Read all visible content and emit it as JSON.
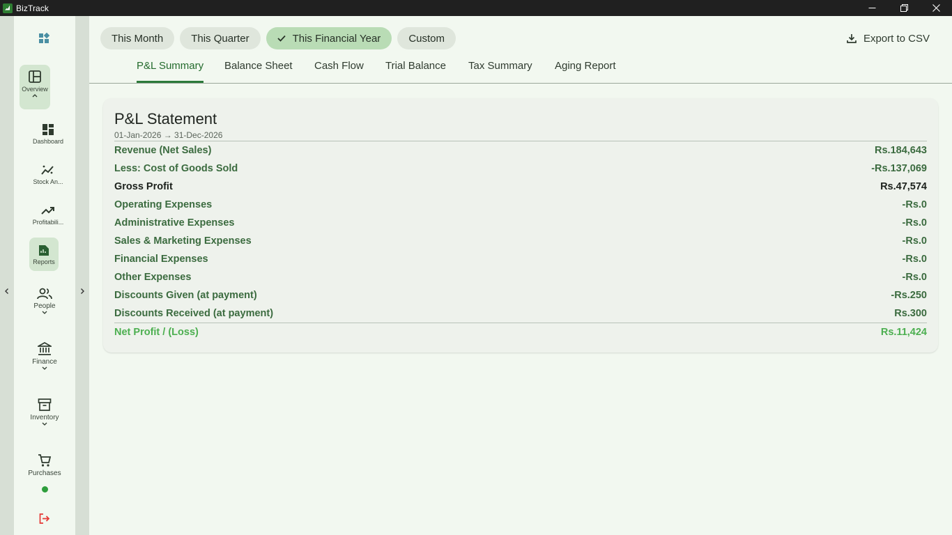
{
  "window": {
    "title": "BizTrack"
  },
  "sidebar": {
    "items": [
      {
        "key": "overview",
        "label": "Overview",
        "icon": "overview-layout-icon"
      },
      {
        "key": "dashboard",
        "label": "Dashboard",
        "icon": "dashboard-icon"
      },
      {
        "key": "stock",
        "label": "Stock An...",
        "icon": "stock-analytics-icon"
      },
      {
        "key": "profitability",
        "label": "Profitabili...",
        "icon": "trending-up-icon"
      },
      {
        "key": "reports",
        "label": "Reports",
        "icon": "reports-icon"
      },
      {
        "key": "people",
        "label": "People",
        "icon": "people-icon"
      },
      {
        "key": "finance",
        "label": "Finance",
        "icon": "bank-icon"
      },
      {
        "key": "inventory",
        "label": "Inventory",
        "icon": "inventory-box-icon"
      },
      {
        "key": "purchases",
        "label": "Purchases",
        "icon": "cart-icon"
      }
    ]
  },
  "filters": {
    "chips": [
      {
        "label": "This Month",
        "selected": false
      },
      {
        "label": "This Quarter",
        "selected": false
      },
      {
        "label": "This Financial Year",
        "selected": true
      },
      {
        "label": "Custom",
        "selected": false
      }
    ],
    "export_label": "Export to CSV"
  },
  "tabs": [
    {
      "label": "P&L Summary",
      "active": true
    },
    {
      "label": "Balance Sheet",
      "active": false
    },
    {
      "label": "Cash Flow",
      "active": false
    },
    {
      "label": "Trial Balance",
      "active": false
    },
    {
      "label": "Tax Summary",
      "active": false
    },
    {
      "label": "Aging Report",
      "active": false
    }
  ],
  "statement": {
    "title": "P&L Statement",
    "period": "01-Jan-2026 → 31-Dec-2026",
    "rows": [
      {
        "label": "Revenue (Net Sales)",
        "value": "Rs.184,643",
        "style": "green"
      },
      {
        "label": "Less: Cost of Goods Sold",
        "value": "-Rs.137,069",
        "style": "green"
      },
      {
        "label": "Gross Profit",
        "value": "Rs.47,574",
        "style": "dark"
      },
      {
        "label": "Operating Expenses",
        "value": "-Rs.0",
        "style": "green"
      },
      {
        "label": "Administrative Expenses",
        "value": "-Rs.0",
        "style": "green"
      },
      {
        "label": "Sales & Marketing Expenses",
        "value": "-Rs.0",
        "style": "green"
      },
      {
        "label": "Financial Expenses",
        "value": "-Rs.0",
        "style": "green"
      },
      {
        "label": "Other Expenses",
        "value": "-Rs.0",
        "style": "green"
      },
      {
        "label": "Discounts Given (at payment)",
        "value": "-Rs.250",
        "style": "green"
      },
      {
        "label": "Discounts Received (at payment)",
        "value": "Rs.300",
        "style": "green"
      }
    ],
    "net": {
      "label": "Net Profit / (Loss)",
      "value": "Rs.11,424"
    }
  },
  "colors": {
    "accent": "#2c7a3a",
    "net_profit": "#4caf50",
    "logout": "#e53935"
  }
}
